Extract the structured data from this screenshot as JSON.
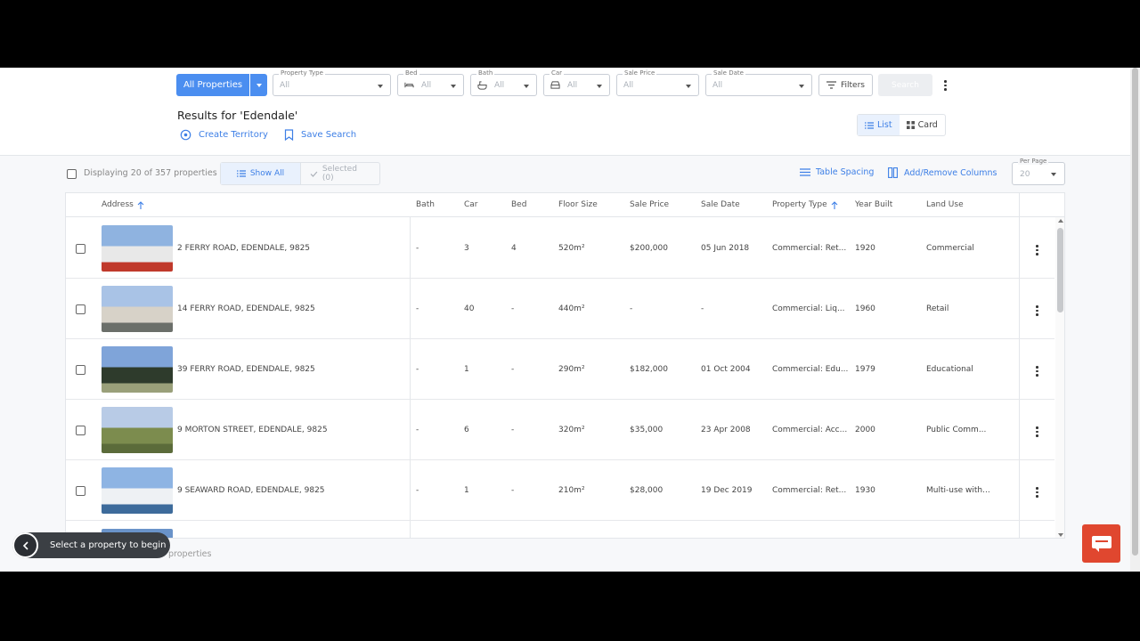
{
  "header": {
    "scope_button": "All Properties",
    "filters": [
      {
        "label": "Property Type",
        "value": "All",
        "icon": "none"
      },
      {
        "label": "Bed",
        "value": "All",
        "icon": "bed-icon"
      },
      {
        "label": "Bath",
        "value": "All",
        "icon": "bath-icon"
      },
      {
        "label": "Car",
        "value": "All",
        "icon": "car-icon"
      },
      {
        "label": "Sale Price",
        "value": "All",
        "icon": "none"
      },
      {
        "label": "Sale Date",
        "value": "All",
        "icon": "none"
      }
    ],
    "filters_button": "Filters",
    "search_button": "Search",
    "title": "Results for 'Edendale'",
    "create_territory": "Create Territory",
    "save_search": "Save Search",
    "view_list": "List",
    "view_card": "Card"
  },
  "toolbar": {
    "displaying": "Displaying 20 of 357 properties",
    "show_all": "Show All",
    "selected": "Selected (0)",
    "table_spacing": "Table Spacing",
    "add_remove_columns": "Add/Remove Columns",
    "per_page_label": "Per Page",
    "per_page_value": "20"
  },
  "table": {
    "columns": [
      "Address",
      "Bath",
      "Car",
      "Bed",
      "Floor Size",
      "Sale Price",
      "Sale Date",
      "Property Type",
      "Year Built",
      "Land Use"
    ],
    "rows": [
      {
        "address": "2 FERRY ROAD, EDENDALE, 9825",
        "bath": "-",
        "car": "3",
        "bed": "4",
        "floor": "520m²",
        "price": "$200,000",
        "date": "05 Jun 2018",
        "type": "Commercial: Ret...",
        "year": "1920",
        "land": "Commercial"
      },
      {
        "address": "14 FERRY ROAD, EDENDALE, 9825",
        "bath": "-",
        "car": "40",
        "bed": "-",
        "floor": "440m²",
        "price": "-",
        "date": "-",
        "type": "Commercial: Liq...",
        "year": "1960",
        "land": "Retail"
      },
      {
        "address": "39 FERRY ROAD, EDENDALE, 9825",
        "bath": "-",
        "car": "1",
        "bed": "-",
        "floor": "290m²",
        "price": "$182,000",
        "date": "01 Oct 2004",
        "type": "Commercial: Edu...",
        "year": "1979",
        "land": "Educational"
      },
      {
        "address": "9 MORTON STREET, EDENDALE, 9825",
        "bath": "-",
        "car": "6",
        "bed": "-",
        "floor": "320m²",
        "price": "$35,000",
        "date": "23 Apr 2008",
        "type": "Commercial: Acc...",
        "year": "2000",
        "land": "Public Comm..."
      },
      {
        "address": "9 SEAWARD ROAD, EDENDALE, 9825",
        "bath": "-",
        "car": "1",
        "bed": "-",
        "floor": "210m²",
        "price": "$28,000",
        "date": "19 Dec 2019",
        "type": "Commercial: Ret...",
        "year": "1930",
        "land": "Multi-use with..."
      }
    ]
  },
  "footer": {
    "toast": "Select a property to begin",
    "bottom_text": "properties"
  },
  "colors": {
    "accent": "#4b8ef0",
    "link": "#3d7fe6",
    "chat": "#e0472f"
  }
}
